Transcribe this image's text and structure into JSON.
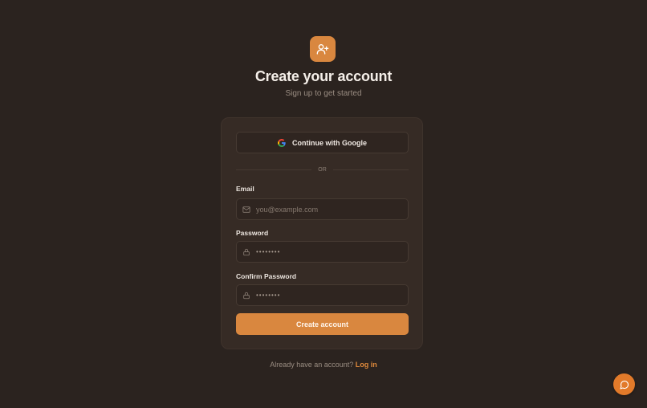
{
  "header": {
    "logo_icon": "user-plus-icon",
    "title": "Create your account",
    "subtitle": "Sign up to get started"
  },
  "form": {
    "google_button_label": "Continue with Google",
    "google_icon": "google-icon",
    "divider_text": "OR",
    "email": {
      "label": "Email",
      "placeholder": "you@example.com",
      "icon": "mail-icon"
    },
    "password": {
      "label": "Password",
      "placeholder": "••••••••",
      "icon": "lock-icon"
    },
    "confirm_password": {
      "label": "Confirm Password",
      "placeholder": "••••••••",
      "icon": "lock-icon"
    },
    "submit_label": "Create account"
  },
  "footer": {
    "prompt": "Already have an account?",
    "login_link": "Log in"
  },
  "chat": {
    "icon": "chat-bubble-icon"
  },
  "colors": {
    "background": "#2b231f",
    "card": "#362b25",
    "accent": "#d9873f",
    "link": "#e08a3c"
  }
}
